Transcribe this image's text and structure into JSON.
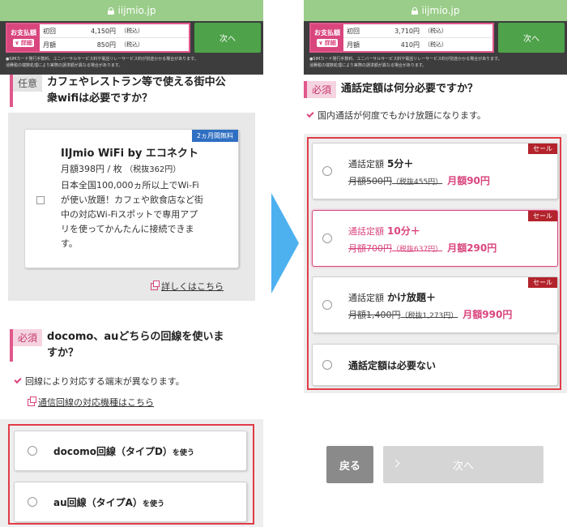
{
  "header": {
    "url": "iijmio.jp",
    "pay_label": "お支払額",
    "detail_label": "詳細",
    "first_label": "初回",
    "monthly_label": "月額",
    "tax_note": "（税込）",
    "next_label": "次へ",
    "footnote_1": "●SIMカード発行手数料、ユニバーサルサービス料や電話リレーサービス料が別途かかる場合があります。",
    "footnote_2": "消費税の端数処理により実際の請求額が異なる場合があります。"
  },
  "left": {
    "first_amount": "4,150円",
    "monthly_amount": "850円",
    "q1": {
      "tag": "任意",
      "title_1": "カフェやレストラン等で使える街中公",
      "title_2": "衆wifiは必要ですか？",
      "card": {
        "badge": "2ヵ月間無料",
        "title": "IIJmio WiFi by エコネクト",
        "price": "月額398円 / 枚",
        "price_tax": "（税抜362円）",
        "desc_1": "日本全国100,000ヵ所以上でWi-Fi",
        "desc_2": "が使い放題！カフェや飲食店など街",
        "desc_3": "中の対応Wi-Fiスポットで専用アプ",
        "desc_4": "リを使ってかんたんに接続できま",
        "desc_5": "す。"
      },
      "link": "詳しくはこちら"
    },
    "q2": {
      "tag": "必須",
      "title_1": "docomo、auどちらの回線を使いま",
      "title_2": "すか？",
      "note": "回線により対応する端末が異なります。",
      "link": "通信回線の対応機種はこちら",
      "options": [
        {
          "label": "docomo回線（タイプD）",
          "suffix": "を使う"
        },
        {
          "label": "au回線（タイプA）",
          "suffix": "を使う"
        }
      ]
    }
  },
  "right": {
    "first_amount": "3,710円",
    "monthly_amount": "410円",
    "q": {
      "tag": "必須",
      "title": "通話定額は何分必要ですか？",
      "note": "国内通話が何度でもかけ放題になります。",
      "sale_label": "セール",
      "options": [
        {
          "prefix": "通話定額",
          "name": "5分＋",
          "old": "月額500円",
          "old_tax": "（税抜455円）",
          "new": "月額90円"
        },
        {
          "prefix": "通話定額",
          "name": "10分＋",
          "old": "月額700円",
          "old_tax": "（税抜637円）",
          "new": "月額290円"
        },
        {
          "prefix": "通話定額",
          "name": "かけ放題＋",
          "old": "月額1,400円",
          "old_tax": "（税抜1,273円）",
          "new": "月額990円"
        }
      ],
      "none_option": "通話定額は必要ない"
    },
    "back_label": "戻る",
    "next_label": "次へ"
  },
  "colors": {
    "accent": "#d9457d",
    "green": "#4ea24a",
    "sale": "#b3232b",
    "highlight_frame": "#e03c47",
    "arrow": "#4db1f0"
  }
}
